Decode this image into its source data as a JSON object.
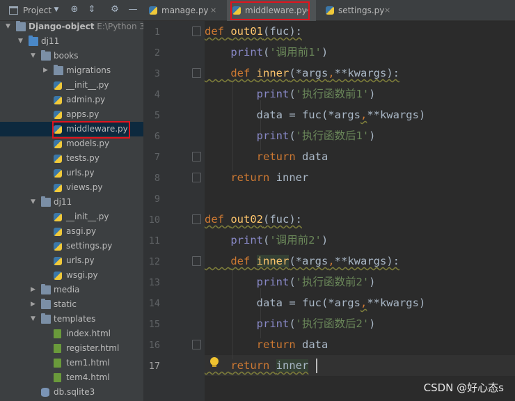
{
  "project_panel": {
    "title": "Project",
    "toolbar_icons": [
      "dropdown-arrow-icon",
      "locate-target-icon",
      "collapse-all-icon",
      "settings-gear-icon",
      "hide-panel-icon"
    ],
    "tree": [
      {
        "label": "Django-object",
        "hint": "E:\\Python 3.",
        "type": "folder",
        "expanded": true
      },
      {
        "label": "dj11",
        "type": "folder-blue",
        "expanded": true
      },
      {
        "label": "books",
        "type": "folder",
        "expanded": true
      },
      {
        "label": "migrations",
        "type": "folder",
        "expanded": false
      },
      {
        "label": "__init__.py",
        "type": "python-file"
      },
      {
        "label": "admin.py",
        "type": "python-file"
      },
      {
        "label": "apps.py",
        "type": "python-file"
      },
      {
        "label": "middleware.py",
        "type": "python-file",
        "selected": true
      },
      {
        "label": "models.py",
        "type": "python-file"
      },
      {
        "label": "tests.py",
        "type": "python-file"
      },
      {
        "label": "urls.py",
        "type": "python-file"
      },
      {
        "label": "views.py",
        "type": "python-file"
      },
      {
        "label": "dj11",
        "type": "folder",
        "expanded": true
      },
      {
        "label": "__init__.py",
        "type": "python-file"
      },
      {
        "label": "asgi.py",
        "type": "python-file"
      },
      {
        "label": "settings.py",
        "type": "python-file"
      },
      {
        "label": "urls.py",
        "type": "python-file"
      },
      {
        "label": "wsgi.py",
        "type": "python-file"
      },
      {
        "label": "media",
        "type": "folder",
        "expanded": false
      },
      {
        "label": "static",
        "type": "folder",
        "expanded": false
      },
      {
        "label": "templates",
        "type": "folder",
        "expanded": true
      },
      {
        "label": "index.html",
        "type": "html-file"
      },
      {
        "label": "register.html",
        "type": "html-file"
      },
      {
        "label": "tem1.html",
        "type": "html-file"
      },
      {
        "label": "tem4.html",
        "type": "html-file"
      },
      {
        "label": "db.sqlite3",
        "type": "database-file"
      }
    ]
  },
  "tabs": [
    {
      "label": "manage.py",
      "close": "×"
    },
    {
      "label": "middleware.py",
      "close": "×",
      "active": true
    },
    {
      "label": "settings.py",
      "close": "×"
    }
  ],
  "editor": {
    "line_numbers": [
      "1",
      "2",
      "3",
      "4",
      "5",
      "6",
      "7",
      "8",
      "9",
      "10",
      "11",
      "12",
      "13",
      "14",
      "15",
      "16",
      "17"
    ],
    "current_line": "17",
    "lines": [
      [
        [
          "kw",
          "def "
        ],
        [
          "fn",
          "out01"
        ],
        [
          "p",
          "(fuc):"
        ]
      ],
      [
        [
          "p",
          "    "
        ],
        [
          "bi",
          "print"
        ],
        [
          "p",
          "("
        ],
        [
          "st",
          "'调用前1'"
        ],
        [
          "p",
          ")"
        ]
      ],
      [
        [
          "p",
          "    "
        ],
        [
          "kw",
          "def "
        ],
        [
          "fn",
          "inner"
        ],
        [
          "p",
          "(*args"
        ],
        [
          "kw",
          ","
        ],
        [
          "p",
          "**kwargs):"
        ]
      ],
      [
        [
          "p",
          "        "
        ],
        [
          "bi",
          "print"
        ],
        [
          "p",
          "("
        ],
        [
          "st",
          "'执行函数前1'"
        ],
        [
          "p",
          ")"
        ]
      ],
      [
        [
          "p",
          "        data = fuc(*args"
        ],
        [
          "kw",
          ","
        ],
        [
          "p",
          "**kwargs)"
        ]
      ],
      [
        [
          "p",
          "        "
        ],
        [
          "bi",
          "print"
        ],
        [
          "p",
          "("
        ],
        [
          "st",
          "'执行函数后1'"
        ],
        [
          "p",
          ")"
        ]
      ],
      [
        [
          "p",
          "        "
        ],
        [
          "kw",
          "return "
        ],
        [
          "p",
          "data"
        ]
      ],
      [
        [
          "p",
          "    "
        ],
        [
          "kw",
          "return "
        ],
        [
          "p",
          "inner"
        ]
      ],
      [],
      [
        [
          "kw",
          "def "
        ],
        [
          "fn",
          "out02"
        ],
        [
          "p",
          "(fuc):"
        ]
      ],
      [
        [
          "p",
          "    "
        ],
        [
          "bi",
          "print"
        ],
        [
          "p",
          "("
        ],
        [
          "st",
          "'调用前2'"
        ],
        [
          "p",
          ")"
        ]
      ],
      [
        [
          "p",
          "    "
        ],
        [
          "kw",
          "def "
        ],
        [
          "fn",
          "inner"
        ],
        [
          "p",
          "(*args"
        ],
        [
          "kw",
          ","
        ],
        [
          "p",
          "**kwargs):"
        ]
      ],
      [
        [
          "p",
          "        "
        ],
        [
          "bi",
          "print"
        ],
        [
          "p",
          "("
        ],
        [
          "st",
          "'执行函数前2'"
        ],
        [
          "p",
          ")"
        ]
      ],
      [
        [
          "p",
          "        data = fuc(*args"
        ],
        [
          "kw",
          ","
        ],
        [
          "p",
          "**kwargs)"
        ]
      ],
      [
        [
          "p",
          "        "
        ],
        [
          "bi",
          "print"
        ],
        [
          "p",
          "("
        ],
        [
          "st",
          "'执行函数后2'"
        ],
        [
          "p",
          ")"
        ]
      ],
      [
        [
          "p",
          "        "
        ],
        [
          "kw",
          "return "
        ],
        [
          "p",
          "data"
        ]
      ],
      [
        [
          "p",
          "    "
        ],
        [
          "kw",
          "return "
        ],
        [
          "p",
          "inner"
        ]
      ]
    ]
  },
  "watermark": "CSDN @好心态s",
  "colors": {
    "annotation_red": "#e0141e",
    "keyword": "#cc7832",
    "function_name": "#ffc66d",
    "string": "#6a8759",
    "builtin": "#8888c6"
  }
}
